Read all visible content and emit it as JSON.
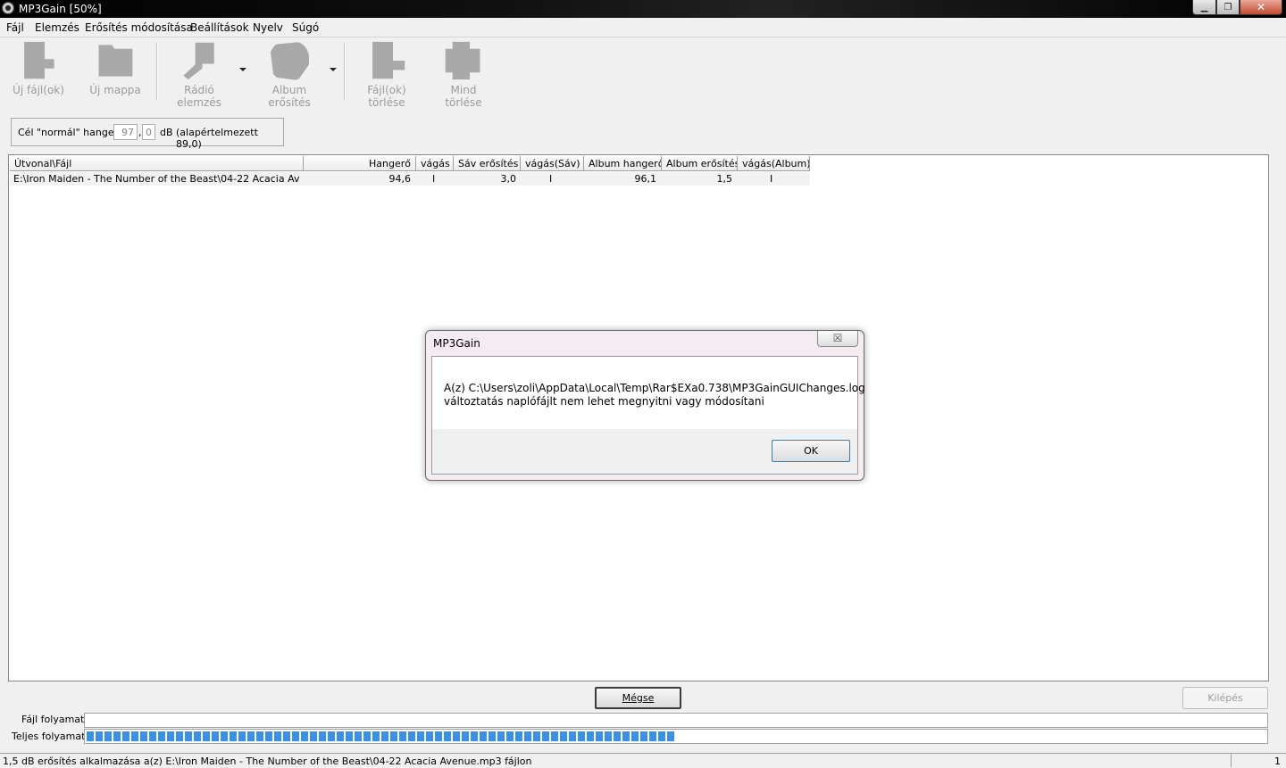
{
  "window": {
    "title": "MP3Gain [50%]",
    "min_glyph": "▁",
    "max_glyph": "❐",
    "close_glyph": "✕"
  },
  "menu": [
    "Fájl",
    "Elemzés",
    "Erősítés módosítása",
    "Beállítások",
    "Nyelv",
    "Súgó"
  ],
  "toolbar": {
    "add_files": "Új fájl(ok)",
    "add_folder": "Új mappa",
    "radio_analysis": "Rádió elemzés",
    "album_gain": "Album erősítés",
    "clear_files": "Fájl(ok) törlése",
    "clear_all": "Mind törlése"
  },
  "target": {
    "label": "Cél \"normál\" hangerő:",
    "int_value": "97",
    "comma": ",",
    "dec_value": "0",
    "unit": "dB",
    "default_note": "(alapértelmezett 89,0)"
  },
  "table": {
    "columns": [
      "Útvonal\\Fájl",
      "Hangerő",
      "vágás",
      "Sáv erősítés",
      "vágás(Sáv)",
      "Album hangerő",
      "Album erősítés",
      "vágás(Album)"
    ],
    "rows": [
      {
        "path": "E:\\Iron Maiden - The Number of the Beast\\04-22 Acacia Avenue...",
        "volume": "94,6",
        "clip": "I",
        "track_gain": "3,0",
        "clip_track": "I",
        "album_volume": "96,1",
        "album_gain": "1,5",
        "clip_album": "I"
      }
    ]
  },
  "buttons": {
    "cancel": "Mégse",
    "exit": "Kilépés"
  },
  "progress": {
    "file_label": "Fájl folyamat",
    "file_value": 0,
    "total_label": "Teljes folyamat",
    "total_value": 0.5
  },
  "status": {
    "text": "1,5 dB erősítés alkalmazása a(z) E:\\Iron Maiden - The Number of the Beast\\04-22 Acacia Avenue.mp3 fájlon",
    "count": "1"
  },
  "dialog": {
    "title": "MP3Gain",
    "close_glyph": "☒",
    "line1": "A(z) C:\\Users\\zoli\\AppData\\Local\\Temp\\Rar$EXa0.738\\MP3GainGUIChanges.log",
    "line2": "változtatás naplófájlt nem lehet megnyitni vagy módosítani",
    "ok": "OK"
  }
}
